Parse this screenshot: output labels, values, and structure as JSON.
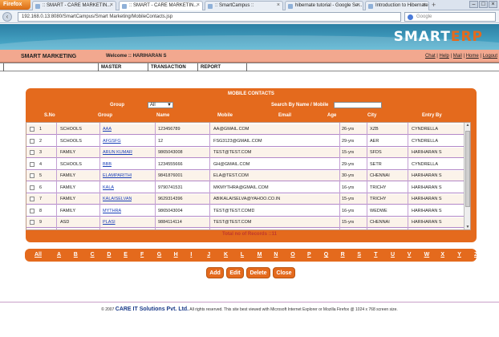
{
  "browser": {
    "menu_label": "Firefox",
    "tabs": [
      {
        "label": ":: SMART - CARE MARKETIN...",
        "active": false
      },
      {
        "label": ":: SMART - CARE MARKETIN...",
        "active": true
      },
      {
        "label": ":: SmartCampus ::",
        "active": false
      },
      {
        "label": "hibernate tutorial - Google Se...",
        "active": false
      },
      {
        "label": "Introduction to Hibernate 3.0",
        "active": false
      }
    ],
    "url": "192.168.0.13:8080/SmartCampus/Smart Marketing/MobileContacts.jsp",
    "search_placeholder": "Google"
  },
  "brand": {
    "logo_main": "SMART",
    "logo_accent": "ERP"
  },
  "header": {
    "module_title": "SMART MARKETING",
    "welcome": "Welcome :: HARIHARAN S",
    "links": [
      "Chat",
      "Help",
      "Mail",
      "Home",
      "Logout"
    ]
  },
  "nav": {
    "items": [
      "MASTER",
      "TRANSACTION",
      "REPORT"
    ]
  },
  "panel": {
    "title": "MOBILE CONTACTS",
    "group_label": "Group",
    "group_value": "All",
    "search_label": "Search By Name / Mobile",
    "columns": [
      "S.No",
      "Group",
      "Name",
      "Mobile",
      "Email",
      "Age",
      "City",
      "Entry By"
    ]
  },
  "rows": [
    {
      "sno": "1",
      "group": "SCHOOLS",
      "name": "AAA",
      "mobile": "123456789",
      "email": "AA@GMAIL.COM",
      "age": "26-yrs",
      "city": "XZB",
      "entry_by": "CYNDRELLA"
    },
    {
      "sno": "2",
      "group": "SCHOOLS",
      "name": "AFGSFG",
      "mobile": "12",
      "email": "FSG3123@GMAIL.COM",
      "age": "29-yrs",
      "city": "AER",
      "entry_by": "CYNDRELLA"
    },
    {
      "sno": "3",
      "group": "FAMILY",
      "name": "ARUN KUMAR",
      "mobile": "9865043008",
      "email": "TEST@TEST.COM",
      "age": "15-yrs",
      "city": "SFDS",
      "entry_by": "HARIHARAN S"
    },
    {
      "sno": "4",
      "group": "SCHOOLS",
      "name": "BBB",
      "mobile": "1234555666",
      "email": "GH@GMAIL.COM",
      "age": "29-yrs",
      "city": "SETR",
      "entry_by": "CYNDRELLA"
    },
    {
      "sno": "5",
      "group": "FAMILY",
      "name": "ELAMPARITHI",
      "mobile": "9841876001",
      "email": "ELA@TEST.COM",
      "age": "30-yrs",
      "city": "CHENNAI",
      "entry_by": "HARIHARAN S"
    },
    {
      "sno": "6",
      "group": "FAMILY",
      "name": "KALA",
      "mobile": "9790741531",
      "email": "MKMYTHRA@GMAIL.COM",
      "age": "16-yrs",
      "city": "TRICHY",
      "entry_by": "HARIHARAN S"
    },
    {
      "sno": "7",
      "group": "FAMILY",
      "name": "KALAISELVAN",
      "mobile": "9629314396",
      "email": "ABIKALAISELVA@YAHOO.CO.IN",
      "age": "15-yrs",
      "city": "TRICHY",
      "entry_by": "HARIHARAN S"
    },
    {
      "sno": "8",
      "group": "FAMILY",
      "name": "MYTHRA",
      "mobile": "9865043004",
      "email": "TEST@TEST.COMD",
      "age": "16-yrs",
      "city": "WEDWE",
      "entry_by": "HARIHARAN S"
    },
    {
      "sno": "9",
      "group": "ASD",
      "name": "PLASI",
      "mobile": "9884114114",
      "email": "TEST@TEST.COM",
      "age": "15-yrs",
      "city": "CHENNAI",
      "entry_by": "HARIHARAN S"
    }
  ],
  "total_records": "Total no of Records ::11",
  "alphabet": [
    "All",
    "A",
    "B",
    "C",
    "D",
    "E",
    "F",
    "G",
    "H",
    "I",
    "J",
    "K",
    "L",
    "M",
    "N",
    "O",
    "P",
    "Q",
    "R",
    "S",
    "T",
    "U",
    "V",
    "W",
    "X",
    "Y",
    "Z"
  ],
  "actions": {
    "add": "Add",
    "edit": "Edit",
    "delete": "Delete",
    "close": "Close"
  },
  "footer": {
    "prefix": "© 2007",
    "company": "CARE IT Solutions Pvt. Ltd.",
    "suffix": "All rights reserved.   This site best viewed with Microsoft Internet Explorer or Mozilla Firefox @ 1024 x 768 screen size."
  },
  "colors": {
    "accent": "#e46a1d",
    "menubar": "#f2a88f",
    "banner": "#2b7ea3"
  }
}
